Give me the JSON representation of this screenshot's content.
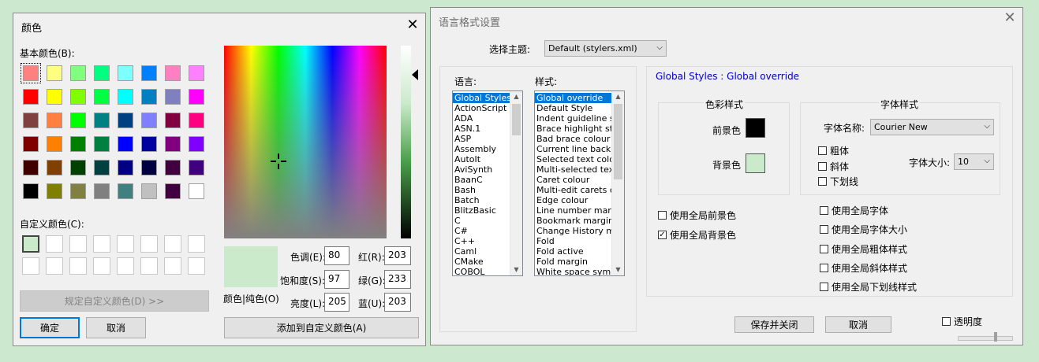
{
  "color_dialog": {
    "title": "颜色",
    "basic_colors_label": "基本颜色(B):",
    "basic_colors": [
      [
        "#ff8080",
        "#ffff80",
        "#80ff80",
        "#00ff80",
        "#80ffff",
        "#0080ff",
        "#ff80c0",
        "#ff80ff"
      ],
      [
        "#ff0000",
        "#ffff00",
        "#80ff00",
        "#00ff40",
        "#00ffff",
        "#0080c0",
        "#8080c0",
        "#ff00ff"
      ],
      [
        "#804040",
        "#ff8040",
        "#00ff00",
        "#008080",
        "#004080",
        "#8080ff",
        "#800040",
        "#ff0080"
      ],
      [
        "#800000",
        "#ff8000",
        "#008000",
        "#008040",
        "#0000ff",
        "#0000a0",
        "#800080",
        "#8000ff"
      ],
      [
        "#400000",
        "#804000",
        "#004000",
        "#004040",
        "#000080",
        "#000040",
        "#400040",
        "#400080"
      ],
      [
        "#000000",
        "#808000",
        "#808040",
        "#808080",
        "#408080",
        "#c0c0c0",
        "#400040",
        "#ffffff"
      ]
    ],
    "custom_colors_label": "自定义颜色(C):",
    "custom_colors": [
      "#cbe9cb",
      "#ffffff",
      "#ffffff",
      "#ffffff",
      "#ffffff",
      "#ffffff",
      "#ffffff",
      "#ffffff",
      "#ffffff",
      "#ffffff",
      "#ffffff",
      "#ffffff",
      "#ffffff",
      "#ffffff",
      "#ffffff",
      "#ffffff"
    ],
    "define_custom_label": "规定自定义颜色(D) >>",
    "ok_label": "确定",
    "cancel_label": "取消",
    "preview_color": "#cbe9cb",
    "color_solid_label": "颜色|纯色(O)",
    "hue_label": "色调(E):",
    "hue_value": "80",
    "sat_label": "饱和度(S):",
    "sat_value": "97",
    "lum_label": "亮度(L):",
    "lum_value": "205",
    "red_label": "红(R):",
    "red_value": "203",
    "green_label": "绿(G):",
    "green_value": "233",
    "blue_label": "蓝(U):",
    "blue_value": "203",
    "add_custom_label": "添加到自定义颜色(A)"
  },
  "style_dialog": {
    "title": "语言格式设置",
    "theme_label": "选择主题:",
    "theme_value": "Default (stylers.xml)",
    "language_label": "语言:",
    "languages": [
      "Global Styles",
      "ActionScript",
      "ADA",
      "ASN.1",
      "ASP",
      "Assembly",
      "AutoIt",
      "AviSynth",
      "BaanC",
      "Bash",
      "Batch",
      "BlitzBasic",
      "C",
      "C#",
      "C++",
      "Caml",
      "CMake",
      "COBOL"
    ],
    "style_label": "样式:",
    "styles": [
      "Global override",
      "Default Style",
      "Indent guideline style",
      "Brace highlight style",
      "Bad brace colour",
      "Current line background colour",
      "Selected text colour",
      "Multi-selected text colour",
      "Caret colour",
      "Multi-edit carets colour",
      "Edge colour",
      "Line number margin",
      "Bookmark margin",
      "Change History margin",
      "Fold",
      "Fold active",
      "Fold margin",
      "White space symbol"
    ],
    "heading": "Global Styles : Global override",
    "color_style_label": "色彩样式",
    "fg_label": "前景色",
    "fg_color": "#000000",
    "bg_label": "背景色",
    "bg_color": "#cbe9cb",
    "font_style_label": "字体样式",
    "font_name_label": "字体名称:",
    "font_name_value": "Courier New",
    "bold_label": "粗体",
    "italic_label": "斜体",
    "underline_label": "下划线",
    "font_size_label": "字体大小:",
    "font_size_value": "10",
    "global_fg_label": "使用全局前景色",
    "global_bg_label": "使用全局背景色",
    "global_font_label": "使用全局字体",
    "global_font_size_label": "使用全局字体大小",
    "global_bold_label": "使用全局粗体样式",
    "global_italic_label": "使用全局斜体样式",
    "global_underline_label": "使用全局下划线样式",
    "save_close_label": "保存并关闭",
    "cancel_label": "取消",
    "transparency_label": "透明度"
  }
}
